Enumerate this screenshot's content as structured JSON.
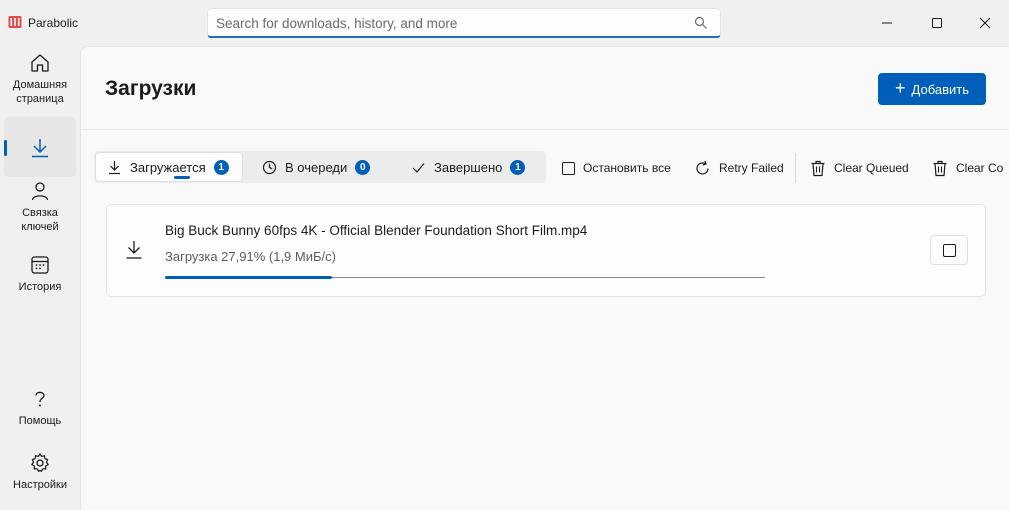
{
  "app": {
    "title": "Parabolic"
  },
  "search": {
    "placeholder": "Search for downloads, history, and more"
  },
  "sidebar": {
    "items": [
      {
        "label": "Домашняя страница",
        "icon": "home-icon"
      },
      {
        "label": "Загрузки",
        "icon": "download-icon",
        "active": true
      },
      {
        "label": "Связка ключей",
        "icon": "person-icon"
      },
      {
        "label": "История",
        "icon": "calendar-icon"
      },
      {
        "label": "Помощь",
        "icon": "help-icon"
      },
      {
        "label": "Настройки",
        "icon": "gear-icon"
      }
    ]
  },
  "header": {
    "title": "Загрузки",
    "add_label": "Добавить"
  },
  "tabs": [
    {
      "label": "Загружается",
      "count": "1",
      "icon": "download-icon",
      "selected": true
    },
    {
      "label": "В очереди",
      "count": "0",
      "icon": "clock-icon"
    },
    {
      "label": "Завершено",
      "count": "1",
      "icon": "check-icon"
    }
  ],
  "toolbar": {
    "stop_all": "Остановить все",
    "retry_failed": "Retry Failed",
    "clear_queued": "Clear Queued",
    "clear_completed": "Clear Co"
  },
  "downloads": [
    {
      "file_name": "Big Buck Bunny 60fps 4K - Official Blender Foundation Short Film.mp4",
      "status": "Загрузка 27,91% (1,9 МиБ/с)",
      "progress": 0.2791
    }
  ],
  "colors": {
    "accent": "#005fb8"
  }
}
